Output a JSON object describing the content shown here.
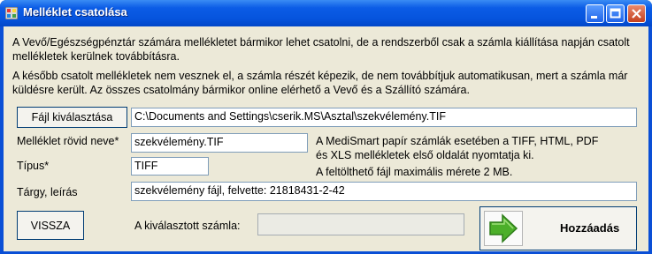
{
  "window": {
    "title": "Melléklet csatolása"
  },
  "intro": {
    "p1": "A Vevő/Egészségpénztár számára mellékletet bármikor lehet csatolni, de a rendszerből csak a számla kiállítása napján csatolt mellékletek kerülnek továbbításra.",
    "p2": "A később csatolt mellékletek nem vesznek el, a számla részét képezik, de nem továbbítjuk automatikusan, mert a számla már küldésre került. Az összes csatolmány bármikor online elérhető a Vevő és a Szállító számára."
  },
  "file": {
    "button_label": "Fájl kiválasztása",
    "path_value": "C:\\Documents and Settings\\cserik.MS\\Asztal\\szekvélemény.TIF"
  },
  "short_name": {
    "label": "Melléklet rövid neve*",
    "value": "szekvélemény.TIF"
  },
  "type": {
    "label": "Típus*",
    "value": "TIFF"
  },
  "subject": {
    "label": "Tárgy, leírás",
    "value": "szekvélemény fájl, felvette: 21818431-2-42"
  },
  "note": {
    "line1": "A MediSmart papír számlák esetében a TIFF, HTML, PDF",
    "line2": "és XLS mellékletek első oldalát nyomtatja ki.",
    "line3": "A feltölthető fájl maximális mérete 2 MB."
  },
  "back_button_label": "VISSZA",
  "selected_invoice": {
    "label": "A kiválasztott számla:",
    "value": ""
  },
  "add_button_label": "Hozzáadás",
  "colors": {
    "titlebar": "#0b5ce6",
    "client": "#ece9d8",
    "arrow_green": "#4caf2a"
  }
}
